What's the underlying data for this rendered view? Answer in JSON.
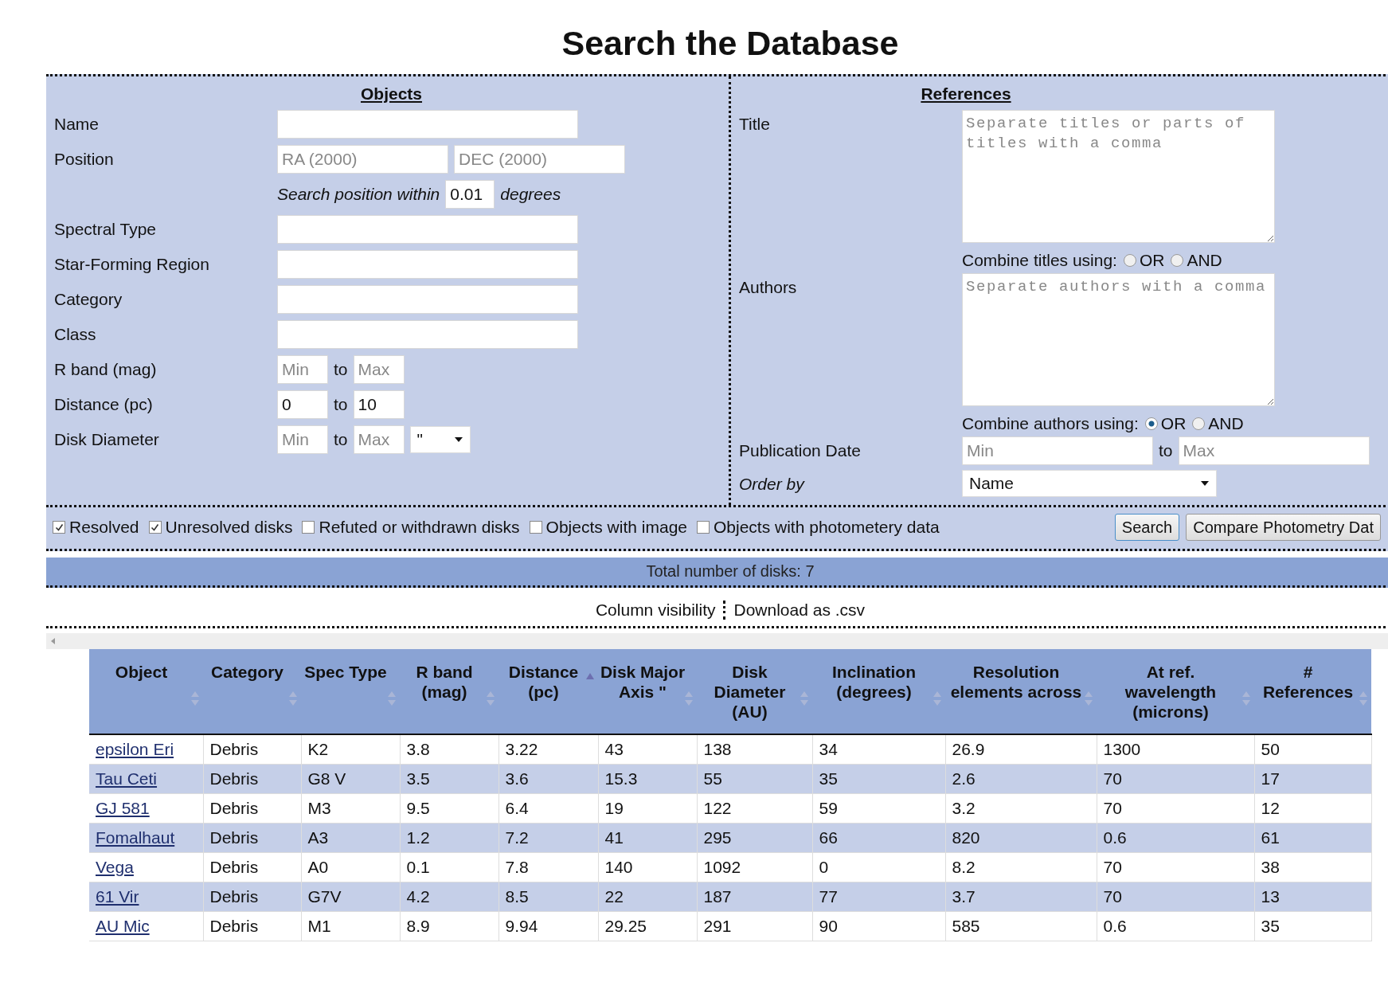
{
  "title": "Search the Database",
  "objects": {
    "heading": "Objects",
    "fields": [
      {
        "kind": "text",
        "label": "Name"
      },
      {
        "kind": "pair",
        "label": "Position",
        "placeholders": [
          "RA (2000)",
          "DEC (2000)"
        ]
      },
      {
        "kind": "within",
        "prefix": "Search position within",
        "value": "0.01",
        "suffix": "degrees"
      },
      {
        "kind": "text",
        "label": "Spectral Type"
      },
      {
        "kind": "text",
        "label": "Star-Forming Region"
      },
      {
        "kind": "text",
        "label": "Category"
      },
      {
        "kind": "text",
        "label": "Class"
      },
      {
        "kind": "range",
        "label": "R band (mag)",
        "min": {
          "placeholder": "Min"
        },
        "sep": "to",
        "max": {
          "placeholder": "Max"
        }
      },
      {
        "kind": "range",
        "label": "Distance (pc)",
        "min": {
          "value": "0"
        },
        "sep": "to",
        "max": {
          "value": "10"
        }
      },
      {
        "kind": "range",
        "label": "Disk Diameter",
        "min": {
          "placeholder": "Min"
        },
        "sep": "to",
        "max": {
          "placeholder": "Max"
        },
        "unit": "\""
      }
    ]
  },
  "references": {
    "heading": "References",
    "title": {
      "label": "Title",
      "placeholder": "Separate titles or parts of titles with a comma",
      "combine": {
        "label": "Combine titles using:",
        "options": [
          {
            "label": "OR",
            "selected": false
          },
          {
            "label": "AND",
            "selected": false
          }
        ]
      }
    },
    "authors": {
      "label": "Authors",
      "placeholder": "Separate authors with a comma",
      "combine": {
        "label": "Combine authors using:",
        "options": [
          {
            "label": "OR",
            "selected": true
          },
          {
            "label": "AND",
            "selected": false
          }
        ]
      }
    },
    "publication_date": {
      "label": "Publication Date",
      "min": {
        "placeholder": "Min"
      },
      "sep": "to",
      "max": {
        "placeholder": "Max"
      }
    },
    "order_by": {
      "label": "Order by",
      "value": "Name"
    }
  },
  "filters": [
    {
      "label": "Resolved",
      "checked": true
    },
    {
      "label": "Unresolved disks",
      "checked": true
    },
    {
      "label": "Refuted or withdrawn disks",
      "checked": false
    },
    {
      "label": "Objects with image",
      "checked": false
    },
    {
      "label": "Objects with photometery data",
      "checked": false
    }
  ],
  "buttons": [
    "Search",
    "Compare Photometry Dat"
  ],
  "total": "Total number of disks: 7",
  "links": [
    "Column visibility",
    "Download as .csv"
  ],
  "table": {
    "columns": [
      {
        "label": "Object",
        "sorted": false
      },
      {
        "label": "Category",
        "sorted": false
      },
      {
        "label": "Spec Type",
        "sorted": false
      },
      {
        "label": "R band\n(mag)",
        "sorted": false
      },
      {
        "label": "Distance\n(pc)",
        "sorted": true
      },
      {
        "label": "Disk Major\nAxis \"",
        "sorted": false
      },
      {
        "label": "Disk\nDiameter\n(AU)",
        "sorted": false
      },
      {
        "label": "Inclination\n(degrees)",
        "sorted": false
      },
      {
        "label": "Resolution\nelements across",
        "sorted": false
      },
      {
        "label": "At ref.\nwavelength\n(microns)",
        "sorted": false
      },
      {
        "label": "#\nReferences",
        "sorted": false
      }
    ],
    "rows": [
      [
        "epsilon Eri",
        "Debris",
        "K2",
        "3.8",
        "3.22",
        "43",
        "138",
        "34",
        "26.9",
        "1300",
        "50"
      ],
      [
        "Tau Ceti",
        "Debris",
        "G8 V",
        "3.5",
        "3.6",
        "15.3",
        "55",
        "35",
        "2.6",
        "70",
        "17"
      ],
      [
        "GJ 581",
        "Debris",
        "M3",
        "9.5",
        "6.4",
        "19",
        "122",
        "59",
        "3.2",
        "70",
        "12"
      ],
      [
        "Fomalhaut",
        "Debris",
        "A3",
        "1.2",
        "7.2",
        "41",
        "295",
        "66",
        "820",
        "0.6",
        "61"
      ],
      [
        "Vega",
        "Debris",
        "A0",
        "0.1",
        "7.8",
        "140",
        "1092",
        "0",
        "8.2",
        "70",
        "38"
      ],
      [
        "61 Vir",
        "Debris",
        "G7V",
        "4.2",
        "8.5",
        "22",
        "187",
        "77",
        "3.7",
        "70",
        "13"
      ],
      [
        "AU Mic",
        "Debris",
        "M1",
        "8.9",
        "9.94",
        "29.25",
        "291",
        "90",
        "585",
        "0.6",
        "35"
      ]
    ]
  }
}
